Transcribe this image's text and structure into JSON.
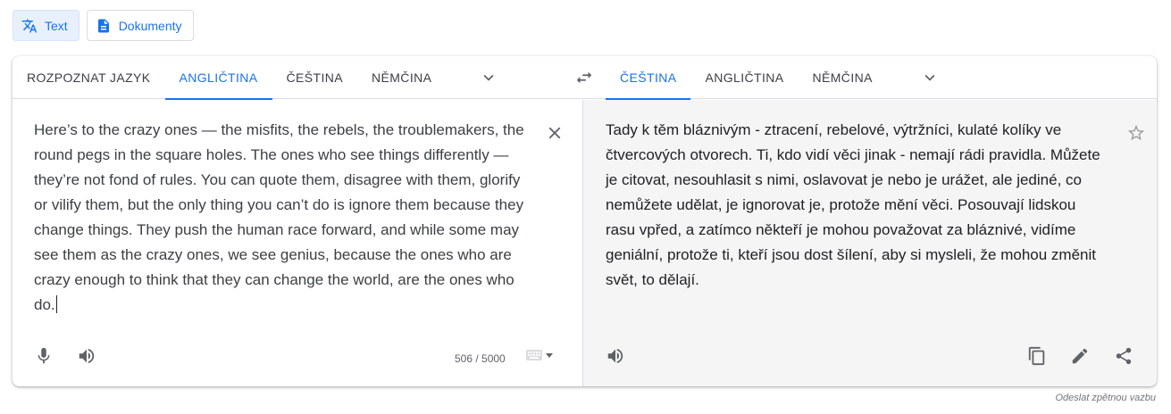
{
  "mode_switch": {
    "text_label": "Text",
    "text_icon": "translate-icon",
    "documents_label": "Dokumenty",
    "documents_icon": "document-icon"
  },
  "source": {
    "tabs": [
      {
        "label": "ROZPOZNAT JAZYK",
        "active": false
      },
      {
        "label": "ANGLIČTINA",
        "active": true
      },
      {
        "label": "ČEŠTINA",
        "active": false
      },
      {
        "label": "NĚMČINA",
        "active": false
      }
    ],
    "text": "Here’s to the crazy ones — the misfits, the rebels, the troublemakers, the round pegs in the square holes. The ones who see things differently — they’re not fond of rules. You can quote them, disagree with them, glorify or vilify them, but the only thing you can’t do is ignore them because they change things. They push the human race forward, and while some may see them as the crazy ones, we see genius, because the ones who are crazy enough to think that they can change the world, are the ones who do.",
    "char_count": "506 / 5000"
  },
  "target": {
    "tabs": [
      {
        "label": "ČEŠTINA",
        "active": true
      },
      {
        "label": "ANGLIČTINA",
        "active": false
      },
      {
        "label": "NĚMČINA",
        "active": false
      }
    ],
    "text": "Tady k těm bláznivým - ztracení, rebelové, výtržníci, kulaté kolíky ve čtvercových otvorech. Ti, kdo vidí věci jinak - nemají rádi pravidla. Můžete je citovat, nesouhlasit s nimi, oslavovat je nebo je urážet, ale jediné, co nemůžete udělat, je ignorovat je, protože mění věci. Posouvají lidskou rasu vpřed, a zatímco někteří je mohou považovat za bláznivé, vidíme geniální, protože ti, kteří jsou dost šílení, aby si mysleli, že mohou změnit svět, to dělají."
  },
  "feedback_label": "Odeslat zpětnou vazbu",
  "colors": {
    "accent": "#1a73e8",
    "icon": "#5f6368",
    "target_bg": "#f5f5f5"
  }
}
